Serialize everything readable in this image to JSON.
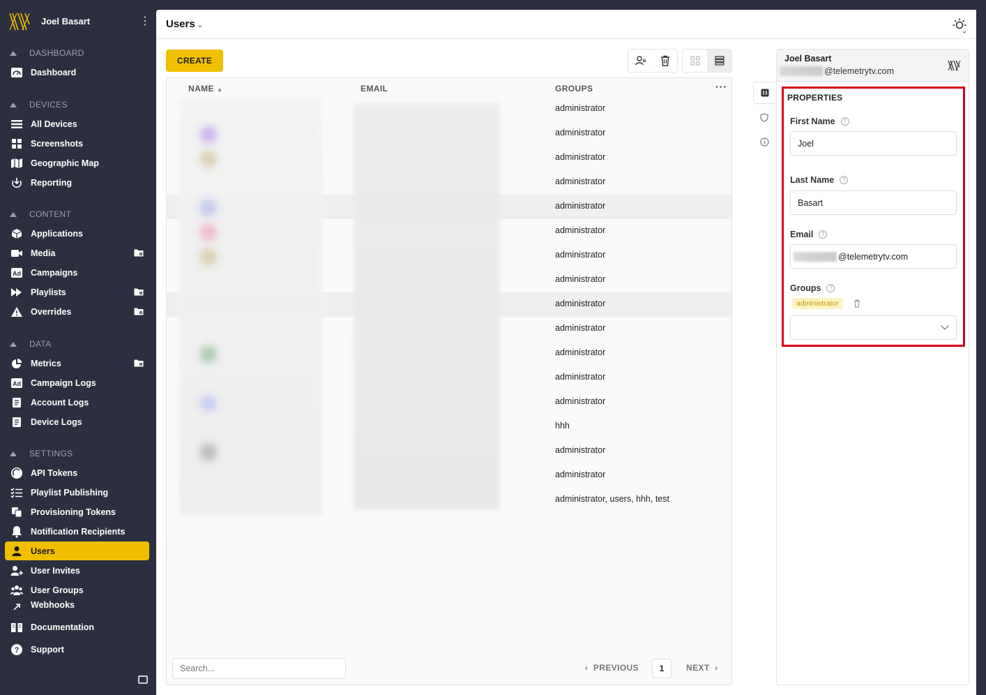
{
  "sidebar": {
    "user_name": "Joel Basart",
    "sections": [
      {
        "label": "DASHBOARD",
        "items": [
          {
            "label": "Dashboard",
            "icon": "dashboard-icon"
          }
        ]
      },
      {
        "label": "DEVICES",
        "items": [
          {
            "label": "All Devices",
            "icon": "list-icon"
          },
          {
            "label": "Screenshots",
            "icon": "grid-icon"
          },
          {
            "label": "Geographic Map",
            "icon": "map-icon"
          },
          {
            "label": "Reporting",
            "icon": "reporting-icon"
          }
        ]
      },
      {
        "label": "CONTENT",
        "items": [
          {
            "label": "Applications",
            "icon": "cube-icon"
          },
          {
            "label": "Media",
            "icon": "camera-icon",
            "folder": true
          },
          {
            "label": "Campaigns",
            "icon": "ad-icon"
          },
          {
            "label": "Playlists",
            "icon": "playlist-icon",
            "folder": true
          },
          {
            "label": "Overrides",
            "icon": "warning-icon",
            "folder": true
          }
        ]
      },
      {
        "label": "DATA",
        "items": [
          {
            "label": "Metrics",
            "icon": "pie-icon",
            "folder": true
          },
          {
            "label": "Campaign Logs",
            "icon": "ad-icon"
          },
          {
            "label": "Account Logs",
            "icon": "log-icon"
          },
          {
            "label": "Device Logs",
            "icon": "log-icon"
          }
        ]
      },
      {
        "label": "SETTINGS",
        "items": [
          {
            "label": "API Tokens",
            "icon": "token-icon"
          },
          {
            "label": "Playlist Publishing",
            "icon": "checklist-icon"
          },
          {
            "label": "Provisioning Tokens",
            "icon": "copy-icon"
          },
          {
            "label": "Notification Recipients",
            "icon": "bell-icon"
          },
          {
            "label": "Users",
            "icon": "user-icon",
            "active": true
          },
          {
            "label": "User Invites",
            "icon": "user-plus-icon"
          },
          {
            "label": "User Groups",
            "icon": "users-icon"
          },
          {
            "label": "Webhooks",
            "icon": "webhook-icon"
          }
        ]
      }
    ],
    "footer": [
      {
        "label": "Documentation",
        "icon": "book-icon"
      },
      {
        "label": "Support",
        "icon": "help-icon"
      }
    ]
  },
  "header": {
    "title": "Users"
  },
  "toolbar": {
    "create_label": "CREATE"
  },
  "table": {
    "columns": [
      "NAME",
      "EMAIL",
      "GROUPS"
    ],
    "rows": [
      "administrator",
      "administrator",
      "administrator",
      "administrator",
      "administrator",
      "administrator",
      "administrator",
      "administrator",
      "administrator",
      "administrator",
      "administrator",
      "administrator",
      "administrator",
      "hhh",
      "administrator",
      "administrator",
      "administrator, users, hhh, test"
    ],
    "highlighted_rows": [
      4,
      8
    ]
  },
  "search": {
    "placeholder": "Search..."
  },
  "pagination": {
    "prev": "PREVIOUS",
    "page": "1",
    "next": "NEXT"
  },
  "panel": {
    "name": "Joel Basart",
    "email_domain": "@telemetrytv.com",
    "properties_title": "PROPERTIES",
    "first_name_label": "First Name",
    "first_name": "Joel",
    "last_name_label": "Last Name",
    "last_name": "Basart",
    "email_label": "Email",
    "groups_label": "Groups",
    "group_tag": "administrator"
  },
  "colors": {
    "accent": "#f0c000",
    "sidebar": "#2b2f3f",
    "highlight_border": "#d9001b"
  }
}
